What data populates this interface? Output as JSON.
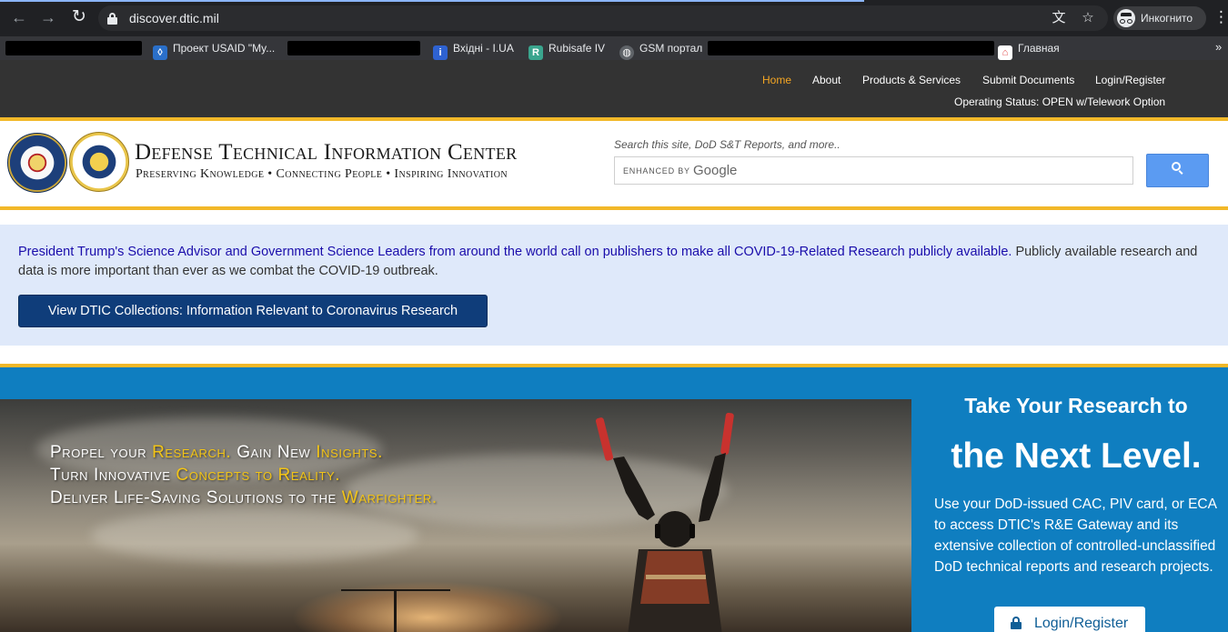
{
  "browser": {
    "url": "discover.dtic.mil",
    "incognito_label": "Инкогнито",
    "back_glyph": "←",
    "forward_glyph": "→",
    "reload_glyph": "↻",
    "translate_glyph": "文",
    "star_glyph": "☆",
    "menu_glyph": "⋮",
    "more_glyph": "»",
    "bookmarks": [
      {
        "label": "Проект USAID \"My...",
        "icon": "usaid-icon",
        "color": "#2a6fc9"
      },
      {
        "label": "Вхідні - I.UA",
        "icon": "i-ua-icon",
        "color": "#2e62d1"
      },
      {
        "label": "Rubisafe IV",
        "icon": "rubisafe-icon",
        "color": "#3aa58e"
      },
      {
        "label": "GSM портал",
        "icon": "globe-icon",
        "color": "#5f6368"
      },
      {
        "label": "Главная",
        "icon": "home-icon",
        "color": "#e24a4a"
      }
    ]
  },
  "site": {
    "nav": [
      {
        "label": "Home",
        "active": true
      },
      {
        "label": "About"
      },
      {
        "label": "Products & Services"
      },
      {
        "label": "Submit Documents"
      },
      {
        "label": "Login/Register"
      }
    ],
    "operating_status": "Operating Status: OPEN w/Telework Option",
    "brand": {
      "title": "Defense Technical Information Center",
      "tagline": "Preserving Knowledge • Connecting People • Inspiring Innovation"
    },
    "search": {
      "hint": "Search this site, DoD S&T Reports, and more..",
      "enhanced_by": "ENHANCED BY",
      "provider": "Google"
    },
    "alert": {
      "link_text": "President Trump's Science Advisor and Government Science Leaders from around the world call on publishers to make all COVID-19-Related Research publicly available.",
      "body_text": " Publicly available research and data is more important than ever as we combat the COVID-19 outbreak.",
      "cta_label": "View DTIC Collections: Information Relevant to Coronavirus Research"
    },
    "hero": {
      "line1": {
        "a": "Propel your ",
        "b": "Research.",
        "c": " Gain New ",
        "d": "Insights."
      },
      "line2": {
        "a": "Turn Innovative ",
        "b": "Concepts to Reality."
      },
      "line3": {
        "a": "Deliver Life-Saving Solutions to the ",
        "b": "Warfighter."
      },
      "side_heading": "Take Your Research to",
      "side_heading_big": "the Next Level.",
      "side_text": "Use your DoD-issued CAC, PIV card, or ECA to access DTIC's R&E Gateway and its extensive collection of controlled-unclassified DoD technical reports and research projects.",
      "login_label": "Login/Register"
    },
    "colors": {
      "topnav_bg": "#333333",
      "active_nav": "#f5a623",
      "gold_rule": "#f2b829",
      "alert_bg": "#dfe9fa",
      "cta_bg": "#0f3d7a",
      "hero_bg": "#0f7ec0",
      "highlight": "#f2c417"
    }
  }
}
